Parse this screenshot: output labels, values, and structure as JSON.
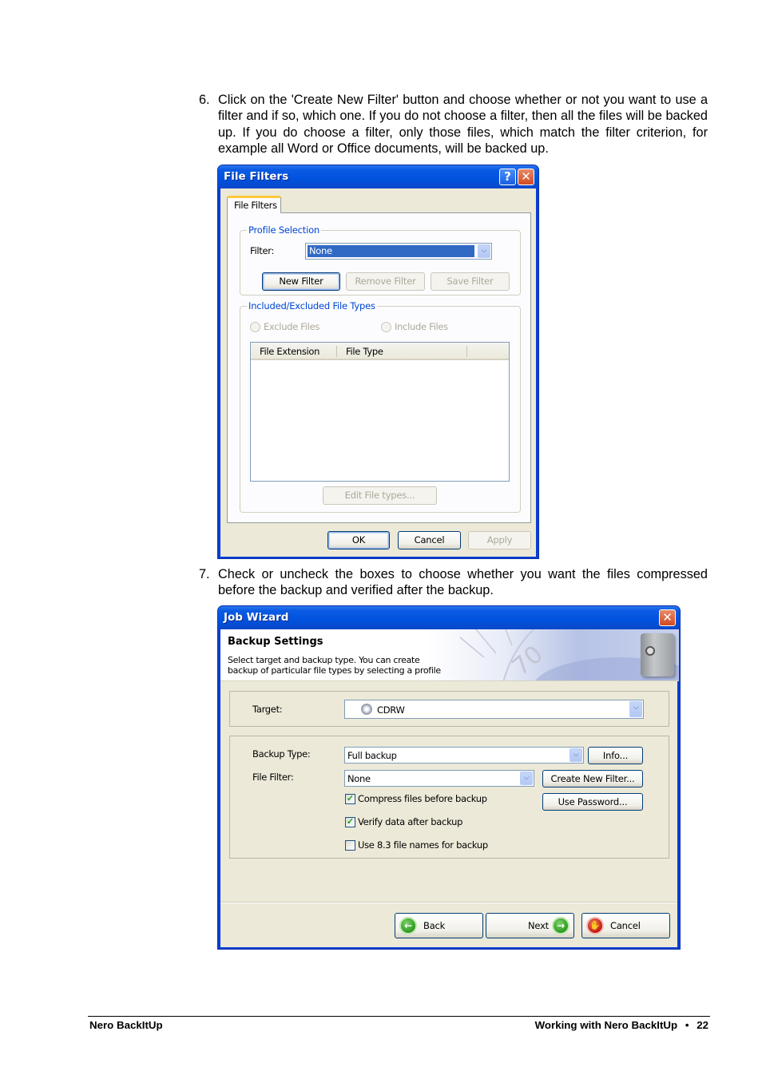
{
  "step6": {
    "number": "6.",
    "text": "Click on the 'Create New Filter' button and choose whether or not you want to use a filter and if so, which one. If you do not choose a filter, then all the files will be backed up. If you do choose a filter, only those files, which match the filter criterion, for example all Word or Office documents, will be backed up."
  },
  "file_filters_dialog": {
    "title": "File Filters",
    "help_icon": "?",
    "close_icon": "✕",
    "tab_label": "File Filters",
    "profile_group": {
      "legend": "Profile Selection",
      "filter_label": "Filter:",
      "filter_value": "None",
      "buttons": {
        "new_filter": "New Filter",
        "remove_filter": "Remove Filter",
        "save_filter": "Save Filter"
      }
    },
    "types_group": {
      "legend": "Included/Excluded File Types",
      "exclude_label": "Exclude Files",
      "include_label": "Include Files",
      "columns": [
        "File Extension",
        "File Type"
      ],
      "rows": [],
      "edit_button": "Edit File types..."
    },
    "ok_button": "OK",
    "cancel_button": "Cancel",
    "apply_button": "Apply"
  },
  "step7": {
    "number": "7.",
    "text": "Check or uncheck the boxes to choose whether you want the files compressed before the backup and verified after the backup."
  },
  "job_wizard_dialog": {
    "title": "Job Wizard",
    "close_icon": "✕",
    "header": {
      "title": "Backup Settings",
      "line1": "Select target and backup type. You can create",
      "line2": "backup of particular file types by selecting a profile",
      "image_caption": "70"
    },
    "target_label": "Target:",
    "target_value": "CDRW",
    "backup_type_label": "Backup Type:",
    "backup_type_value": "Full backup",
    "info_button": "Info...",
    "file_filter_label": "File Filter:",
    "file_filter_value": "None",
    "create_filter_button": "Create New Filter...",
    "use_password_button": "Use Password...",
    "checkboxes": [
      {
        "label": "Compress files before backup",
        "checked": true
      },
      {
        "label": "Verify data after backup",
        "checked": true
      },
      {
        "label": "Use 8.3 file names for backup",
        "checked": false
      }
    ],
    "check_mark": "✓",
    "back_button": "Back",
    "next_button": "Next",
    "cancel_button": "Cancel"
  },
  "footer": {
    "left": "Nero BackItUp",
    "right": "Working with Nero BackItUp",
    "bullet": "•",
    "page": "22"
  }
}
